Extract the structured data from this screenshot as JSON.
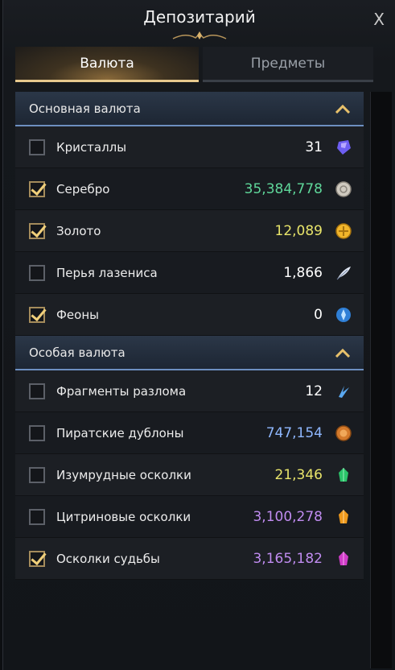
{
  "window": {
    "title": "Депозитарий",
    "close_label": "X"
  },
  "tabs": [
    {
      "label": "Валюта",
      "active": true
    },
    {
      "label": "Предметы",
      "active": false
    }
  ],
  "sections": [
    {
      "title": "Основная валюта",
      "items": [
        {
          "label": "Кристаллы",
          "value": "31",
          "checked": false,
          "value_color": "#ffffff",
          "icon": "crystal-icon"
        },
        {
          "label": "Серебро",
          "value": "35,384,778",
          "checked": true,
          "value_color": "#5fd79a",
          "icon": "silver-coin-icon"
        },
        {
          "label": "Золото",
          "value": "12,089",
          "checked": true,
          "value_color": "#e8e46a",
          "icon": "gold-coin-icon"
        },
        {
          "label": "Перья лазениса",
          "value": "1,866",
          "checked": false,
          "value_color": "#ffffff",
          "icon": "feather-icon"
        },
        {
          "label": "Феоны",
          "value": "0",
          "checked": true,
          "value_color": "#ffffff",
          "icon": "pheon-icon"
        }
      ]
    },
    {
      "title": "Особая валюта",
      "items": [
        {
          "label": "Фрагменты разлома",
          "value": "12",
          "checked": false,
          "value_color": "#ffffff",
          "icon": "rift-shard-icon"
        },
        {
          "label": "Пиратские дублоны",
          "value": "747,154",
          "checked": false,
          "value_color": "#8fb8ff",
          "icon": "doubloon-icon"
        },
        {
          "label": "Изумрудные осколки",
          "value": "21,346",
          "checked": false,
          "value_color": "#e8e46a",
          "icon": "emerald-shard-icon"
        },
        {
          "label": "Цитриновые осколки",
          "value": "3,100,278",
          "checked": false,
          "value_color": "#c08cf0",
          "icon": "citrine-shard-icon"
        },
        {
          "label": "Осколки судьбы",
          "value": "3,165,182",
          "checked": true,
          "value_color": "#c08cf0",
          "icon": "destiny-shard-icon"
        }
      ]
    }
  ]
}
